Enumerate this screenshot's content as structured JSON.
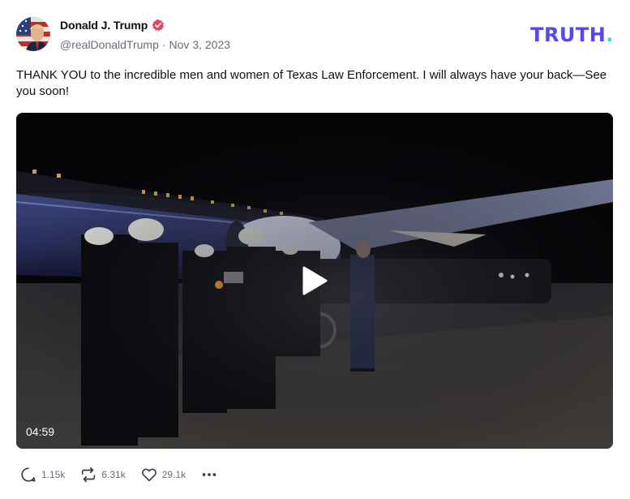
{
  "author": {
    "display_name": "Donald J. Trump",
    "handle": "@realDonaldTrump",
    "separator": "·",
    "date": "Nov 3, 2023",
    "verified": true
  },
  "brand": {
    "logo_text": "TRUTH",
    "logo_dot": ".",
    "primary_color": "#5448ee",
    "accent_color": "#27e0c8",
    "verified_color": "#e5475c"
  },
  "post": {
    "text": "THANK YOU to the incredible men and women of Texas Law Enforcement. I will always have your back—See you soon!"
  },
  "media": {
    "type": "video",
    "duration": "04:59",
    "play_icon": "play-icon"
  },
  "actions": {
    "replies": "1.15k",
    "retruths": "6.31k",
    "likes": "29.1k",
    "reply_icon": "reply-icon",
    "retruth_icon": "retruth-icon",
    "like_icon": "heart-icon",
    "more_icon": "more-icon"
  }
}
